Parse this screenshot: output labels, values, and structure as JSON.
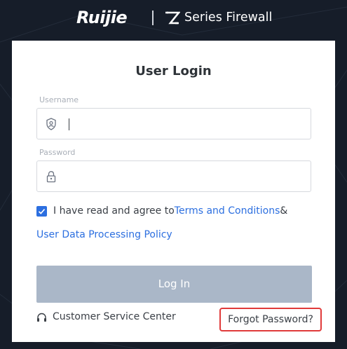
{
  "header": {
    "logo_text": "Ruijie",
    "product_name": "Series Firewall",
    "product_icon": "z-series-logo-icon"
  },
  "login": {
    "title": "User Login",
    "username": {
      "label": "Username",
      "value": "",
      "icon": "user-shield-icon"
    },
    "password": {
      "label": "Password",
      "value": "",
      "icon": "lock-icon"
    },
    "agreement": {
      "checked": true,
      "prefix": "I have read and agree to",
      "terms_link": "Terms and Conditions",
      "connector": "&",
      "policy_link": "User Data Processing Policy"
    },
    "login_button": "Log In",
    "customer_service": "Customer Service Center",
    "customer_service_icon": "headset-icon",
    "forgot_password": "Forgot Password?"
  },
  "colors": {
    "background": "#161d29",
    "accent": "#2c6fe0",
    "button_disabled": "#aab7c8",
    "highlight_border": "#e03a3a"
  }
}
